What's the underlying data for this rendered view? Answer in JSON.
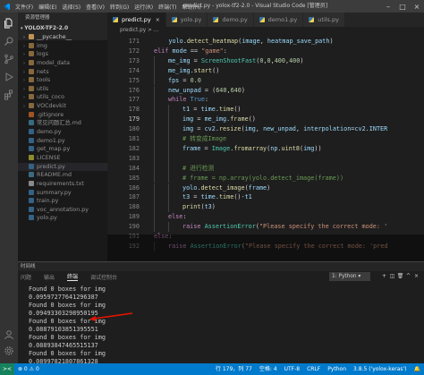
{
  "titlebar": {
    "menu": [
      "文件(F)",
      "编辑(E)",
      "选择(S)",
      "查看(V)",
      "转到(G)",
      "运行(R)",
      "终端(T)",
      "帮助(H)"
    ],
    "title": "predict.py - yolox-tf2-2.0 - Visual Studio Code [管理员]"
  },
  "sidebar": {
    "title": "资源管理器",
    "project": "YOLOX-TF2-2.0",
    "items": [
      {
        "label": "__pycache__",
        "kind": "folder"
      },
      {
        "label": "img",
        "kind": "folder"
      },
      {
        "label": "logs",
        "kind": "folder"
      },
      {
        "label": "model_data",
        "kind": "folder"
      },
      {
        "label": "nets",
        "kind": "folder"
      },
      {
        "label": "tools",
        "kind": "folder"
      },
      {
        "label": "utils",
        "kind": "folder"
      },
      {
        "label": "utils_coco",
        "kind": "folder"
      },
      {
        "label": "VOCdevkit",
        "kind": "folder"
      },
      {
        "label": ".gitignore",
        "kind": "git"
      },
      {
        "label": "常见问题汇总.md",
        "kind": "md"
      },
      {
        "label": "demo.py",
        "kind": "py"
      },
      {
        "label": "demo1.py",
        "kind": "py"
      },
      {
        "label": "get_map.py",
        "kind": "py"
      },
      {
        "label": "LICENSE",
        "kind": "license"
      },
      {
        "label": "predict.py",
        "kind": "py"
      },
      {
        "label": "README.md",
        "kind": "md"
      },
      {
        "label": "requirements.txt",
        "kind": "txt"
      },
      {
        "label": "summary.py",
        "kind": "py"
      },
      {
        "label": "train.py",
        "kind": "py"
      },
      {
        "label": "voc_annotation.py",
        "kind": "py"
      },
      {
        "label": "yolo.py",
        "kind": "py"
      }
    ]
  },
  "tabs": [
    {
      "label": "predict.py",
      "active": true,
      "closable": true
    },
    {
      "label": "yolo.py",
      "active": false,
      "closable": false
    },
    {
      "label": "demo.py",
      "active": false,
      "closable": false
    },
    {
      "label": "demo1.py",
      "active": false,
      "closable": false
    },
    {
      "label": "utils.py",
      "active": false,
      "closable": false
    }
  ],
  "breadcrumb": "predict.py > ...",
  "editor": {
    "lines": [
      {
        "n": "171",
        "indent": 0,
        "code": "    yolo.detect_heatmap(image, heatmap_save_path)"
      },
      {
        "n": "172",
        "indent": 0,
        "code": "elif mode == \"game\":"
      },
      {
        "n": "173",
        "indent": 1,
        "code": "me_img = ScreenShootFast(0,0,400,400)"
      },
      {
        "n": "174",
        "indent": 1,
        "code": "me_img.start()"
      },
      {
        "n": "175",
        "indent": 1,
        "code": "fps = 0.0"
      },
      {
        "n": "176",
        "indent": 1,
        "code": "new_unpad = (640,640)"
      },
      {
        "n": "177",
        "indent": 1,
        "code": "while True:"
      },
      {
        "n": "178",
        "indent": 2,
        "code": "t1 = time.time()"
      },
      {
        "n": "179",
        "indent": 2,
        "code": "img = me_img.frame()"
      },
      {
        "n": "180",
        "indent": 2,
        "code": "img = cv2.resize(img, new_unpad, interpolation=cv2.INTER"
      },
      {
        "n": "181",
        "indent": 2,
        "code": "# 转变成Image"
      },
      {
        "n": "182",
        "indent": 2,
        "code": "frame = Image.fromarray(np.uint8(img))"
      },
      {
        "n": "183",
        "indent": 2,
        "code": ""
      },
      {
        "n": "184",
        "indent": 2,
        "code": "# 进行检测"
      },
      {
        "n": "185",
        "indent": 2,
        "code": "# frame = np.array(yolo.detect_image(frame))"
      },
      {
        "n": "186",
        "indent": 2,
        "code": "yolo.detect_image(frame)"
      },
      {
        "n": "187",
        "indent": 2,
        "code": "t3 = time.time()-t1"
      },
      {
        "n": "188",
        "indent": 2,
        "code": "print(t3)"
      },
      {
        "n": "189",
        "indent": 1,
        "code": "else:"
      },
      {
        "n": "190",
        "indent": 2,
        "code": "raise AssertionError(\"Please specify the correct mode: '"
      },
      {
        "n": "191",
        "indent": 0,
        "code": "else:"
      },
      {
        "n": "192",
        "indent": 1,
        "code": "raise AssertionError(\"Please specify the correct mode: 'pred"
      }
    ]
  },
  "panel": {
    "header": "时间线",
    "tabs": [
      "问题",
      "输出",
      "终端",
      "调试控制台"
    ],
    "active_tab": "终端",
    "terminal_select": "1: Python",
    "terminal_lines": [
      "Found 0 boxes for img",
      "0.09597277641296387",
      "Found 0 boxes for img",
      "0.09493303298950195",
      "Found 0 boxes for img",
      "0.08879103851395551",
      "Found 0 boxes for img",
      "0.08893847465515137",
      "Found 0 boxes for img",
      "0.08997821807861328"
    ]
  },
  "statusbar": {
    "left": [
      "⊗ 0 ⚠ 0"
    ],
    "right": [
      "行 179，列 77",
      "空格: 4",
      "UTF-8",
      "CRLF",
      "Python",
      "3.8.5 ('yolox-keras')"
    ]
  },
  "colors": {
    "statusbar": "#007acc",
    "accent": "#e51400",
    "editor_bg": "#1e1e1e"
  }
}
